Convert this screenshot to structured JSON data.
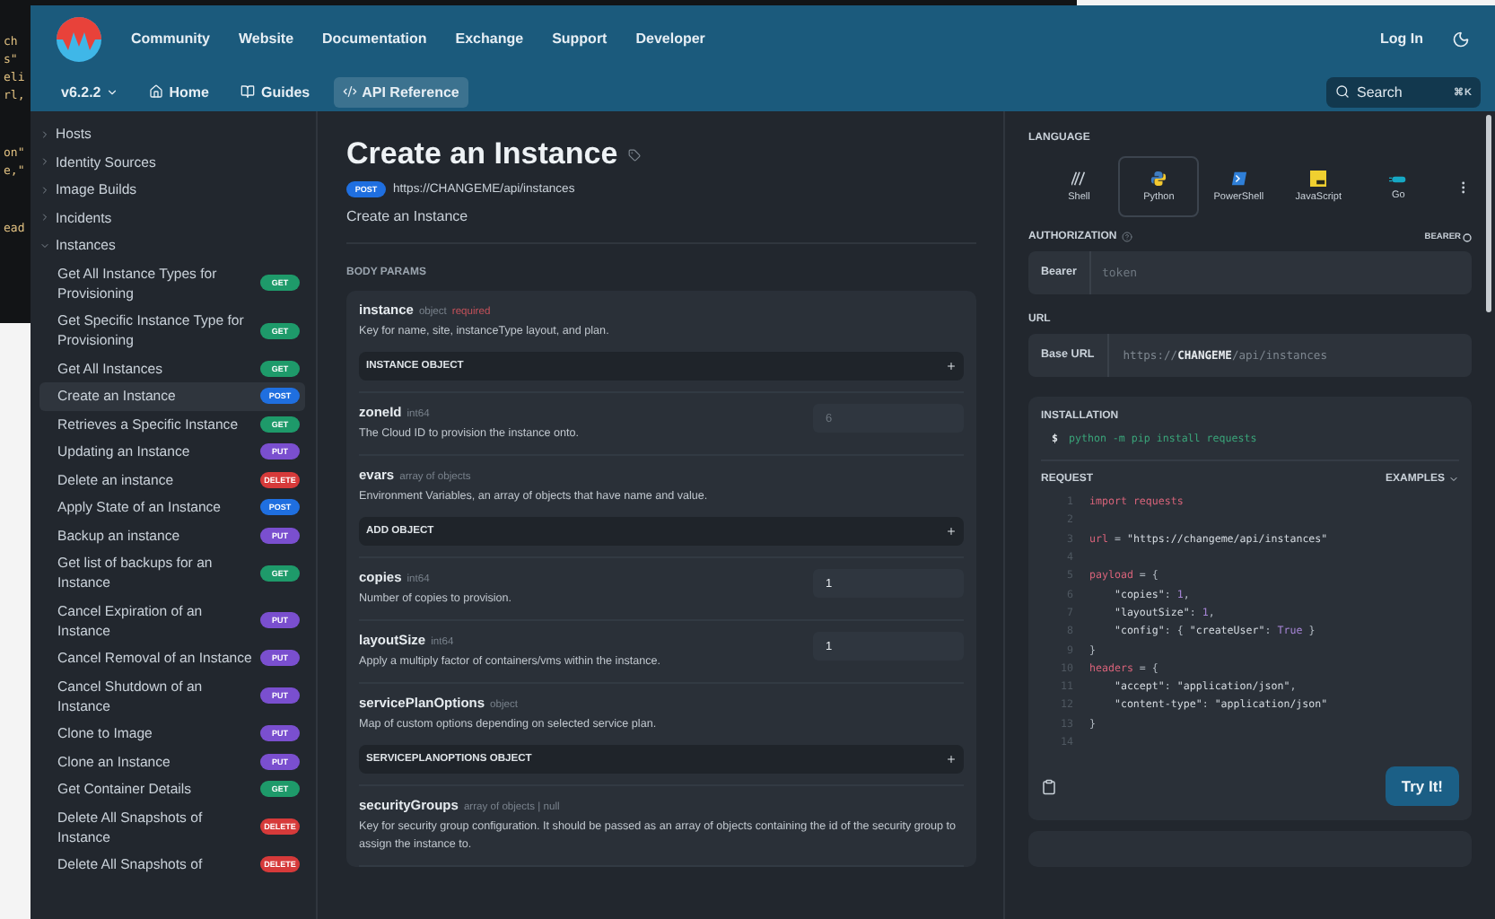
{
  "backdrop_editor": {
    "blocks": [
      [
        "ch",
        "s\"",
        "eli",
        "rl,"
      ],
      [
        "on\"",
        "e,\""
      ],
      [
        "ead"
      ]
    ]
  },
  "header": {
    "nav": [
      "Community",
      "Website",
      "Documentation",
      "Exchange",
      "Support",
      "Developer"
    ],
    "login": "Log In",
    "version": "v6.2.2",
    "tabs": [
      {
        "label": "Home",
        "kind": "home",
        "selected": false
      },
      {
        "label": "Guides",
        "kind": "book",
        "selected": false
      },
      {
        "label": "API Reference",
        "kind": "code",
        "selected": true
      }
    ],
    "search": {
      "placeholder": "Search",
      "shortcut": "⌘K"
    }
  },
  "sidebar": {
    "items": [
      {
        "label": "Hosts",
        "expanded": false
      },
      {
        "label": "Identity Sources",
        "expanded": false
      },
      {
        "label": "Image Builds",
        "expanded": false
      },
      {
        "label": "Incidents",
        "expanded": false
      },
      {
        "label": "Instances",
        "expanded": true,
        "children": [
          {
            "label": "Get All Instance Types for Provisioning",
            "method": "GET",
            "kind": "get",
            "selected": false
          },
          {
            "label": "Get Specific Instance Type for Provisioning",
            "method": "GET",
            "kind": "get",
            "selected": false
          },
          {
            "label": "Get All Instances",
            "method": "GET",
            "kind": "get",
            "selected": false
          },
          {
            "label": "Create an Instance",
            "method": "POST",
            "kind": "post",
            "selected": true
          },
          {
            "label": "Retrieves a Specific Instance",
            "method": "GET",
            "kind": "get",
            "selected": false
          },
          {
            "label": "Updating an Instance",
            "method": "PUT",
            "kind": "put",
            "selected": false
          },
          {
            "label": "Delete an instance",
            "method": "DELETE",
            "kind": "delete",
            "selected": false
          },
          {
            "label": "Apply State of an Instance",
            "method": "POST",
            "kind": "post",
            "selected": false
          },
          {
            "label": "Backup an instance",
            "method": "PUT",
            "kind": "put",
            "selected": false
          },
          {
            "label": "Get list of backups for an Instance",
            "method": "GET",
            "kind": "get",
            "selected": false
          },
          {
            "label": "Cancel Expiration of an Instance",
            "method": "PUT",
            "kind": "put",
            "selected": false
          },
          {
            "label": "Cancel Removal of an Instance",
            "method": "PUT",
            "kind": "put",
            "selected": false
          },
          {
            "label": "Cancel Shutdown of an Instance",
            "method": "PUT",
            "kind": "put",
            "selected": false
          },
          {
            "label": "Clone to Image",
            "method": "PUT",
            "kind": "put",
            "selected": false
          },
          {
            "label": "Clone an Instance",
            "method": "PUT",
            "kind": "put",
            "selected": false
          },
          {
            "label": "Get Container Details",
            "method": "GET",
            "kind": "get",
            "selected": false
          },
          {
            "label": "Delete All Snapshots of Instance",
            "method": "DELETE",
            "kind": "delete",
            "selected": false
          },
          {
            "label": "Delete All Snapshots of",
            "method": "DELETE",
            "kind": "delete",
            "selected": false
          }
        ]
      }
    ]
  },
  "main": {
    "title": "Create an Instance",
    "method": "POST",
    "kind": "post",
    "url": "https://CHANGEME/api/instances",
    "description": "Create an Instance",
    "section": "BODY PARAMS",
    "params": [
      {
        "name": "instance",
        "type": "object",
        "required": "required",
        "description": "Key for name, site, instanceType layout, and plan.",
        "kind": "object",
        "action": "INSTANCE OBJECT"
      },
      {
        "name": "zoneId",
        "type": "int64",
        "description": "The Cloud ID to provision the instance onto.",
        "kind": "input",
        "placeholder": "6"
      },
      {
        "name": "evars",
        "type": "array of objects",
        "description": "Environment Variables, an array of objects that have name and value.",
        "kind": "object",
        "action": "ADD OBJECT"
      },
      {
        "name": "copies",
        "type": "int64",
        "description": "Number of copies to provision.",
        "kind": "input",
        "value": "1"
      },
      {
        "name": "layoutSize",
        "type": "int64",
        "description": "Apply a multiply factor of containers/vms within the instance.",
        "kind": "input",
        "value": "1"
      },
      {
        "name": "servicePlanOptions",
        "type": "object",
        "description": "Map of custom options depending on selected service plan.",
        "kind": "object",
        "action": "SERVICEPLANOPTIONS OBJECT"
      },
      {
        "name": "securityGroups",
        "type": "array of objects | null",
        "description": "Key for security group configuration. It should be passed as an array of objects containing the id of the security group to assign the instance to.",
        "kind": "text"
      }
    ]
  },
  "panel": {
    "language_label": "LANGUAGE",
    "languages": [
      {
        "label": "Shell",
        "kind": "shell",
        "selected": false
      },
      {
        "label": "Python",
        "kind": "python",
        "selected": true
      },
      {
        "label": "PowerShell",
        "kind": "powershell",
        "selected": false
      },
      {
        "label": "JavaScript",
        "kind": "javascript",
        "selected": false
      },
      {
        "label": "Go",
        "kind": "go",
        "selected": false
      }
    ],
    "auth_label": "AUTHORIZATION",
    "auth_scheme": "BEARER",
    "auth_field": {
      "label": "Bearer",
      "placeholder": "token"
    },
    "url_label": "URL",
    "url_field": {
      "label": "Base URL",
      "prefix": "https://",
      "host": "CHANGEME",
      "path": "/api/instances"
    },
    "install_label": "INSTALLATION",
    "install_prompt": "$",
    "install_command": "python -m pip install requests",
    "request_label": "REQUEST",
    "examples": "EXAMPLES",
    "code": [
      {
        "number": "1",
        "tokens": [
          {
            "kind": "keyword",
            "text": "import"
          },
          {
            "kind": "name",
            "text": " requests"
          }
        ]
      },
      {
        "number": "2"
      },
      {
        "number": "3",
        "tokens": [
          {
            "kind": "name",
            "text": "url"
          },
          {
            "kind": "punct",
            "text": " = "
          },
          {
            "kind": "string",
            "text": "\"https://changeme/api/instances\""
          }
        ]
      },
      {
        "number": "4"
      },
      {
        "number": "5",
        "tokens": [
          {
            "kind": "name",
            "text": "payload"
          },
          {
            "kind": "punct",
            "text": " = {"
          }
        ]
      },
      {
        "number": "6",
        "tokens": [
          {
            "kind": "string",
            "text": "    \"copies\""
          },
          {
            "kind": "punct",
            "text": ": "
          },
          {
            "kind": "number",
            "text": "1"
          },
          {
            "kind": "punct",
            "text": ","
          }
        ]
      },
      {
        "number": "7",
        "tokens": [
          {
            "kind": "string",
            "text": "    \"layoutSize\""
          },
          {
            "kind": "punct",
            "text": ": "
          },
          {
            "kind": "number",
            "text": "1"
          },
          {
            "kind": "punct",
            "text": ","
          }
        ]
      },
      {
        "number": "8",
        "tokens": [
          {
            "kind": "string",
            "text": "    \"config\""
          },
          {
            "kind": "punct",
            "text": ": { "
          },
          {
            "kind": "string",
            "text": "\"createUser\""
          },
          {
            "kind": "punct",
            "text": ": "
          },
          {
            "kind": "number",
            "text": "True"
          },
          {
            "kind": "punct",
            "text": " }"
          }
        ]
      },
      {
        "number": "9",
        "tokens": [
          {
            "kind": "punct",
            "text": "}"
          }
        ]
      },
      {
        "number": "10",
        "tokens": [
          {
            "kind": "name",
            "text": "headers"
          },
          {
            "kind": "punct",
            "text": " = {"
          }
        ]
      },
      {
        "number": "11",
        "tokens": [
          {
            "kind": "string",
            "text": "    \"accept\""
          },
          {
            "kind": "punct",
            "text": ": "
          },
          {
            "kind": "string",
            "text": "\"application/json\""
          },
          {
            "kind": "punct",
            "text": ","
          }
        ]
      },
      {
        "number": "12",
        "tokens": [
          {
            "kind": "string",
            "text": "    \"content-type\""
          },
          {
            "kind": "punct",
            "text": ": "
          },
          {
            "kind": "string",
            "text": "\"application/json\""
          }
        ]
      },
      {
        "number": "13",
        "tokens": [
          {
            "kind": "punct",
            "text": "}"
          }
        ]
      },
      {
        "number": "14"
      }
    ],
    "try_button": "Try It!"
  }
}
